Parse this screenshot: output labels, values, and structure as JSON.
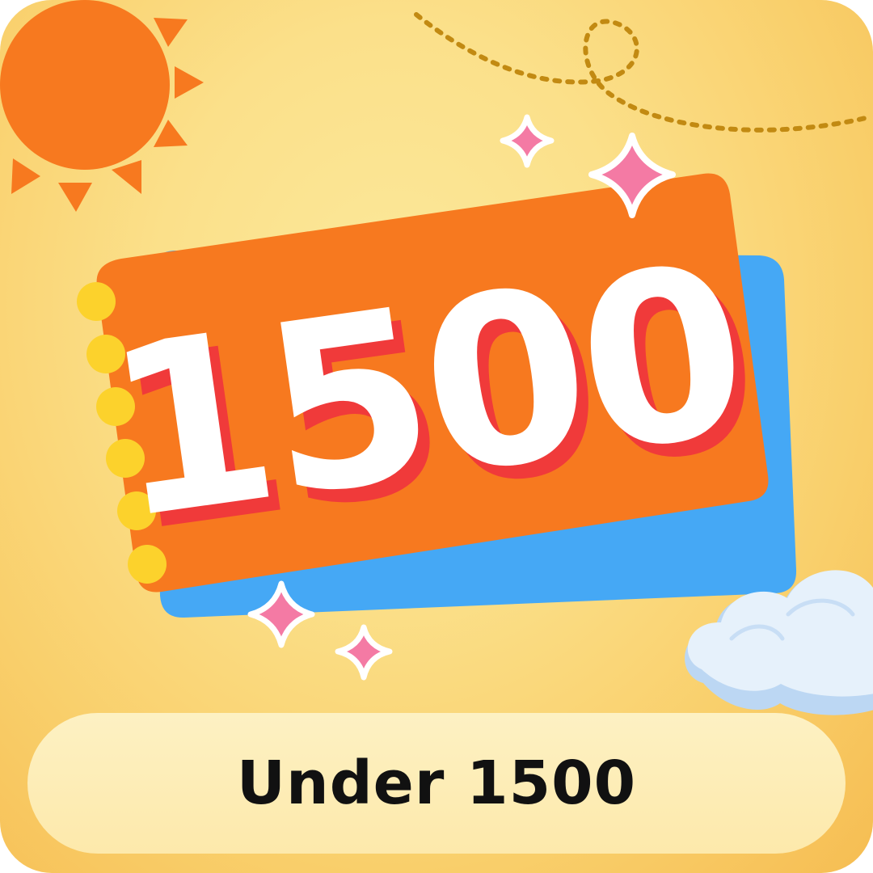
{
  "tile": {
    "label": "Under 1500",
    "badge_number": "1500"
  },
  "colors": {
    "background": "#fbe08a",
    "sun": "#f7791f",
    "ticket": "#f7791f",
    "ticket_back": "#45a8f5",
    "number_fill": "#ffffff",
    "number_shadow": "#f03a3a",
    "dots": "#fcd22c",
    "sparkle": "#f47aa4",
    "cloud": "#e6f1fb",
    "label_pill": "#fdedb5",
    "label_text": "#111111"
  },
  "decorations": {
    "sun": "sun-icon",
    "sparkles": "sparkle-icon",
    "cloud": "cloud-icon",
    "path": "dotted-path"
  }
}
